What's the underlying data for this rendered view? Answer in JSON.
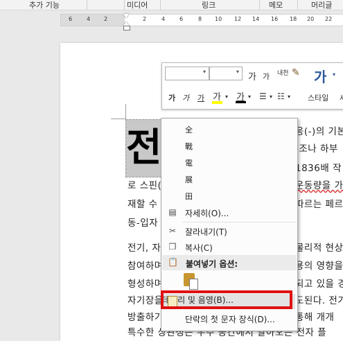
{
  "ribbon": {
    "groups": [
      "추가 기능",
      "미디어",
      "링크",
      "메모",
      "머리글"
    ]
  },
  "ruler": {
    "numbers": [
      "6",
      "4",
      "2",
      "2",
      "4",
      "6",
      "8",
      "10",
      "12",
      "14",
      "16",
      "18",
      "20",
      "22"
    ]
  },
  "mini_toolbar": {
    "font_size_grow": "가",
    "font_size_shrink": "가",
    "phonetic": "내천",
    "bold": "가",
    "italic": "가",
    "underline": "가",
    "highlight": "가",
    "font_color": "가",
    "styles_label": "스타일",
    "extra": "세"
  },
  "document": {
    "big_char": "전",
    "lines": [
      {
        "text": "응(-)의 기본"
      },
      {
        "text": "-조나 하부"
      },
      {
        "text": "1836배 작"
      },
      {
        "text": "로 스핀(",
        "tail": "운동량을 가"
      },
      {
        "text": "재할 수",
        "tail": "따르는 페르"
      },
      {
        "text": "동-입자"
      },
      {
        "text": "전기, 자",
        "tail": "물리적 현상"
      },
      {
        "text": "참여하며",
        "tail": "용의 영향을"
      },
      {
        "text": "형성하며",
        "tail": "되고 있을 경"
      },
      {
        "text": "자기장을",
        "tail": "도된다. 전기"
      },
      {
        "text": "방출하기",
        "tail": "통해 개개"
      },
      {
        "text": "특수한 상관성은 우주 공간에서 날아오는 전자 플"
      }
    ]
  },
  "context_menu": {
    "char_options": [
      "全",
      "戰",
      "電",
      "展",
      "田"
    ],
    "details": "자세히(O)...",
    "cut": "잘라내기(T)",
    "copy": "복사(C)",
    "paste_options_header": "붙여넣기 옵션:",
    "border_shading": "테두리 및 음영(B)...",
    "drop_cap": "단락의 첫 문자 장식(D)..."
  },
  "colors": {
    "highlight_box": "#e01010",
    "highlight_bar": "#ffff00",
    "font_color_bar": "#000000",
    "styles_icon": "#2b579a"
  }
}
